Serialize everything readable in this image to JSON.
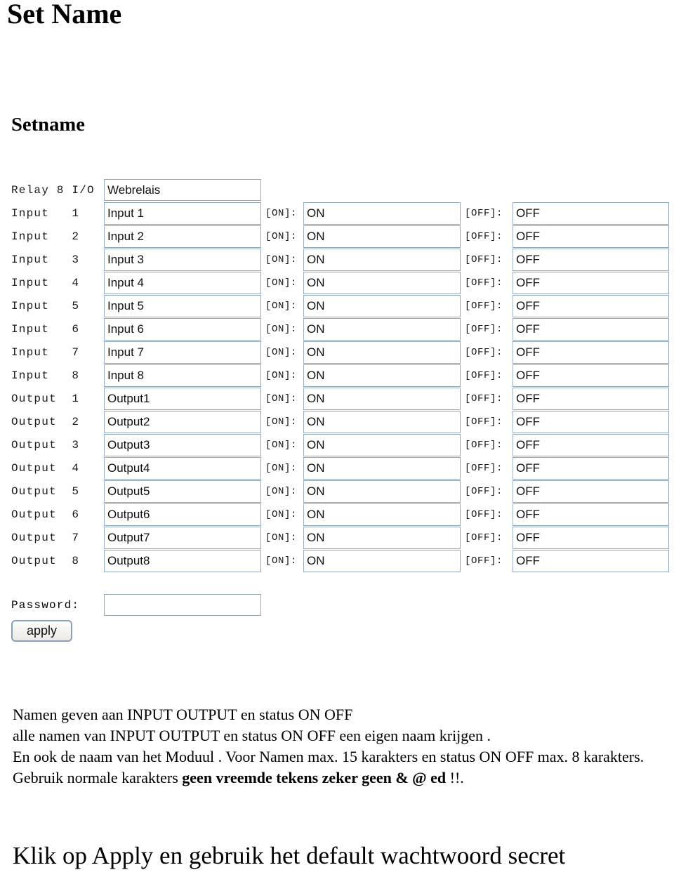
{
  "page": {
    "title": "Set Name"
  },
  "form": {
    "heading": "Setname",
    "device_label": "Relay 8 I/O",
    "device_name": "Webrelais",
    "on_tag": "[ON]:",
    "off_tag": "[OFF]:",
    "password_label": "Password:",
    "password_value": "",
    "apply_label": "apply",
    "colors": {
      "field_border": "#92a7bb",
      "button_border": "#8ba0b4",
      "text": "#000000",
      "background": "#ffffff"
    },
    "rows": [
      {
        "label": "Input   1",
        "name": "Input 1",
        "on": "ON",
        "off": "OFF"
      },
      {
        "label": "Input   2",
        "name": "Input 2",
        "on": "ON",
        "off": "OFF"
      },
      {
        "label": "Input   3",
        "name": "Input 3",
        "on": "ON",
        "off": "OFF"
      },
      {
        "label": "Input   4",
        "name": "Input 4",
        "on": "ON",
        "off": "OFF"
      },
      {
        "label": "Input   5",
        "name": "Input 5",
        "on": "ON",
        "off": "OFF"
      },
      {
        "label": "Input   6",
        "name": "Input 6",
        "on": "ON",
        "off": "OFF"
      },
      {
        "label": "Input   7",
        "name": "Input 7",
        "on": "ON",
        "off": "OFF"
      },
      {
        "label": "Input   8",
        "name": "Input 8",
        "on": "ON",
        "off": "OFF"
      },
      {
        "label": "Output  1",
        "name": "Output1",
        "on": "ON",
        "off": "OFF"
      },
      {
        "label": "Output  2",
        "name": "Output2",
        "on": "ON",
        "off": "OFF"
      },
      {
        "label": "Output  3",
        "name": "Output3",
        "on": "ON",
        "off": "OFF"
      },
      {
        "label": "Output  4",
        "name": "Output4",
        "on": "ON",
        "off": "OFF"
      },
      {
        "label": "Output  5",
        "name": "Output5",
        "on": "ON",
        "off": "OFF"
      },
      {
        "label": "Output  6",
        "name": "Output6",
        "on": "ON",
        "off": "OFF"
      },
      {
        "label": "Output  7",
        "name": "Output7",
        "on": "ON",
        "off": "OFF"
      },
      {
        "label": "Output  8",
        "name": "Output8",
        "on": "ON",
        "off": "OFF"
      }
    ]
  },
  "notes": {
    "line1": "Namen geven aan INPUT OUTPUT en status ON OFF",
    "line2": "alle namen van INPUT OUTPUT en status ON OFF een eigen naam krijgen .",
    "line3": "En ook de naam van het Moduul . Voor Namen max. 15 karakters en status ON OFF max. 8 karakters.",
    "line4_prefix": "Gebruik normale karakters ",
    "line4_bold": "geen vreemde tekens zeker geen & @ ed ",
    "line4_suffix": "!!."
  },
  "final": {
    "text": "Klik op Apply  en gebruik het default wachtwoord secret"
  }
}
